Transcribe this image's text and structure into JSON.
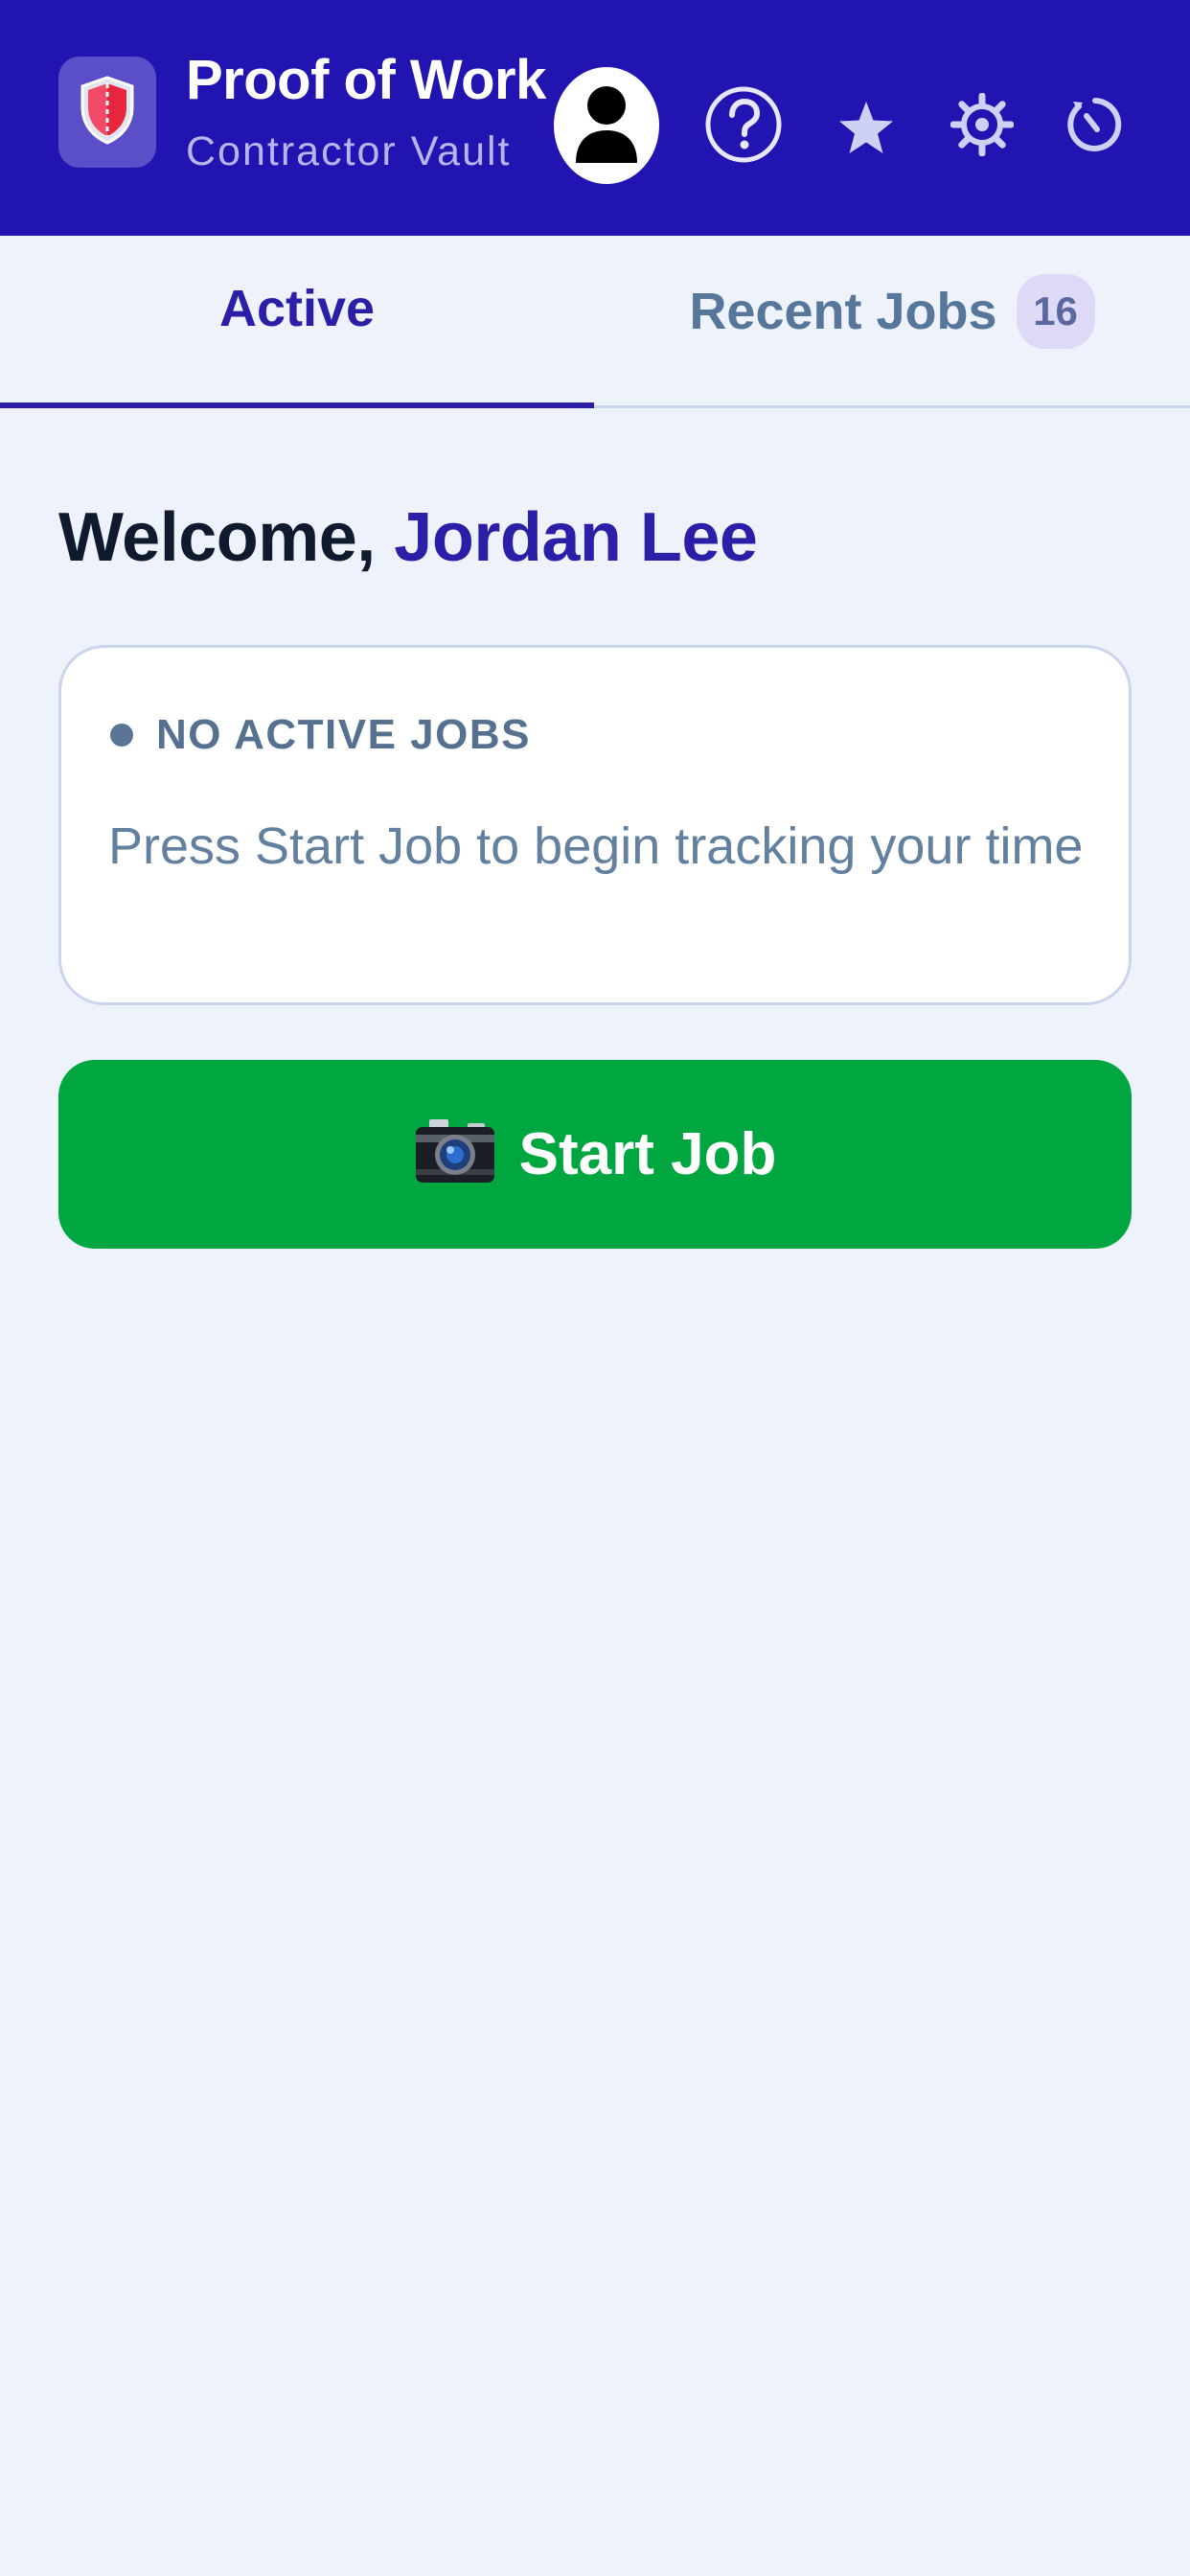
{
  "header": {
    "title": "Proof of Work",
    "subtitle": "Contractor Vault",
    "icons": [
      "shield-icon",
      "user-icon",
      "help-icon",
      "star-icon",
      "settings-icon",
      "history-icon"
    ]
  },
  "tabs": [
    {
      "label": "Active",
      "active": true
    },
    {
      "label": "Recent Jobs",
      "badge": "16",
      "active": false
    }
  ],
  "main": {
    "welcome_prefix": "Welcome, ",
    "user_name": "Jordan Lee",
    "status": {
      "label": "NO ACTIVE JOBS",
      "message": "Press Start Job to begin tracking your time"
    },
    "start_button": {
      "label": "Start Job",
      "icon": "camera-icon"
    }
  },
  "colors": {
    "header_bg": "#2114b0",
    "accent": "#2a1fa6",
    "start_button": "#00a63f",
    "page_bg": "#eef2fb"
  }
}
